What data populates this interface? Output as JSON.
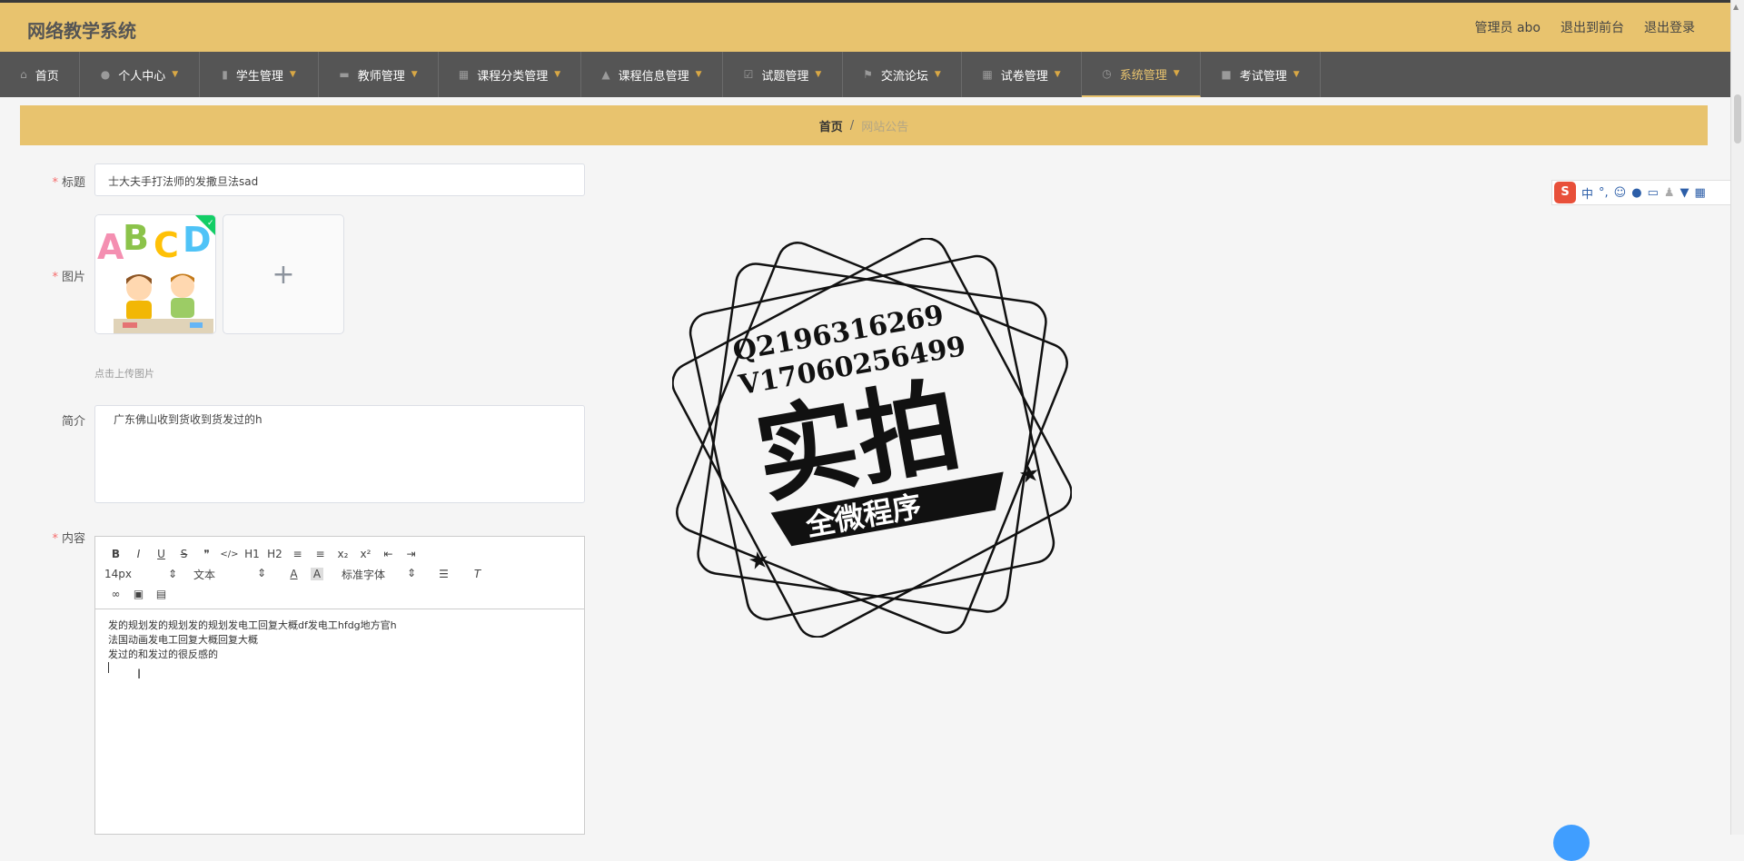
{
  "app_title": "网络教学系统",
  "top_links": {
    "user": "管理员 abo",
    "front": "退出到前台",
    "logout": "退出登录"
  },
  "nav": [
    {
      "label": "首页",
      "icon": "home-icon"
    },
    {
      "label": "个人中心",
      "icon": "user-icon"
    },
    {
      "label": "学生管理",
      "icon": "chart-icon"
    },
    {
      "label": "教师管理",
      "icon": "briefcase-icon"
    },
    {
      "label": "课程分类管理",
      "icon": "grid-icon"
    },
    {
      "label": "课程信息管理",
      "icon": "thumb-up-icon"
    },
    {
      "label": "试题管理",
      "icon": "checkbox-icon"
    },
    {
      "label": "交流论坛",
      "icon": "flag-icon"
    },
    {
      "label": "试卷管理",
      "icon": "apps-icon"
    },
    {
      "label": "系统管理",
      "icon": "clock-icon",
      "active": true
    },
    {
      "label": "考试管理",
      "icon": "camera-icon"
    }
  ],
  "breadcrumb": {
    "home": "首页",
    "sep": "/",
    "current": "网站公告"
  },
  "form": {
    "title_label": "标题",
    "title_value": "士大夫手打法师的发撒旦法sad",
    "image_label": "图片",
    "upload_hint": "点击上传图片",
    "intro_label": "简介",
    "intro_value": "广东佛山收到货收到货发过的h",
    "content_label": "内容",
    "required_mark": "*"
  },
  "editor": {
    "size_select": "14px",
    "format_select": "文本",
    "font_select": "标准字体",
    "toolbar_row1": [
      "B",
      "I",
      "U",
      "S",
      "❞",
      "</>",
      "H1",
      "H2",
      "≡",
      "≡",
      "x₂",
      "x²",
      "⇤",
      "⇥"
    ],
    "content_lines": [
      "发的规划发的规划发的规划发电工回复大概df发电工hfdg地方官h",
      "法国动画发电工回复大概回复大概",
      "发过的和发过的很反感的"
    ]
  },
  "watermark": {
    "line1": "Q2196316269",
    "line2": "V17060256499",
    "main": "实拍",
    "ribbon": "全微程序"
  },
  "ime": {
    "logo": "S",
    "mode": "中",
    "punct": "°,"
  },
  "colors": {
    "header": "#e8c36e",
    "nav": "#555555",
    "active": "#e8c36e"
  }
}
